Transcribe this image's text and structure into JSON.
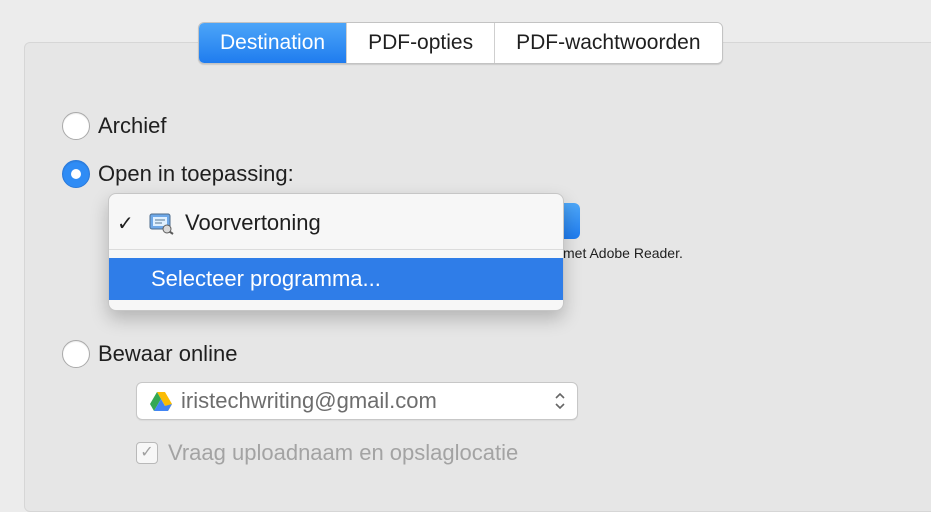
{
  "tabs": [
    {
      "label": "Destination",
      "active": true
    },
    {
      "label": "PDF-opties",
      "active": false
    },
    {
      "label": "PDF-wachtwoorden",
      "active": false
    }
  ],
  "destination": {
    "archive_label": "Archief",
    "open_in_app_label": "Open in toepassing:",
    "app_hint": "met Adobe Reader.",
    "save_online_label": "Bewaar online",
    "account_email": "iristechwriting@gmail.com",
    "ask_upload_location_label": "Vraag uploadnaam en opslaglocatie"
  },
  "popup": {
    "checked_mark": "✓",
    "selected_app": "Voorvertoning",
    "select_program": "Selecteer programma..."
  },
  "colors": {
    "accent": "#2f7de8",
    "tab_active": "#1f7cef",
    "disabled_text": "#a3a3a3"
  },
  "icons": {
    "preview": "preview-app-icon",
    "drive": "google-drive-icon",
    "stepper": "up-down-stepper-icon"
  }
}
